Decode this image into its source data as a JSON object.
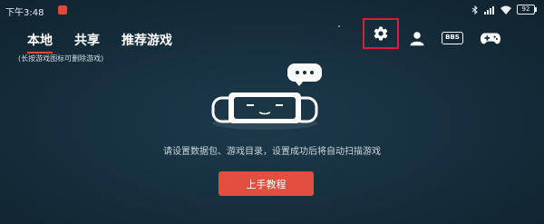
{
  "status_bar": {
    "time": "下午3:48",
    "battery": "92"
  },
  "tabs": [
    {
      "label": "本地",
      "active": true
    },
    {
      "label": "共享",
      "active": false
    },
    {
      "label": "推荐游戏",
      "active": false
    }
  ],
  "hint": "(长按游戏图标可删除游戏)",
  "toolbar": {
    "icons": [
      "gear-icon",
      "user-icon",
      "bbs-icon",
      "gamepad-icon"
    ],
    "bbs_label": "BBS"
  },
  "empty_state": {
    "message": "请设置数据包、游戏目录，设置成功后将自动扫描游戏",
    "button_label": "上手教程"
  },
  "colors": {
    "accent": "#e34f3f",
    "highlight_box": "#d6203a",
    "background": "#16303f"
  }
}
